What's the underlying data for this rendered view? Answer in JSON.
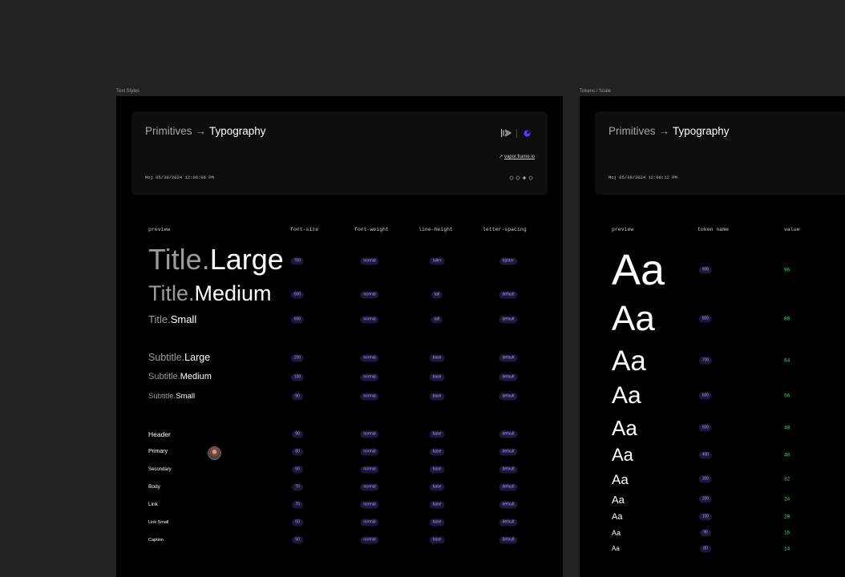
{
  "frames": {
    "text_styles": {
      "label": "Text Styles",
      "header": {
        "crumb_parent": "Primitives",
        "crumb_arrow": "→",
        "crumb_current": "Typography",
        "timestamp": "Moj 05/30/2024 12:06:06 PM",
        "link_arrow": "↗",
        "link_text": "vapor.frame.io"
      },
      "columns": [
        "preview",
        "font-size",
        "font-weight",
        "line-height",
        "letter-spacing"
      ],
      "rows": [
        {
          "prefix": "Title.",
          "name": "Large",
          "size": "700",
          "weight": "normal",
          "lh": "taller",
          "ls": "tighter"
        },
        {
          "prefix": "Title.",
          "name": "Medium",
          "size": "600",
          "weight": "normal",
          "lh": "tall",
          "ls": "default"
        },
        {
          "prefix": "Title.",
          "name": "Small",
          "size": "600",
          "weight": "normal",
          "lh": "tall",
          "ls": "default"
        },
        {
          "prefix": "Subtitle.",
          "name": "Large",
          "size": "200",
          "weight": "normal",
          "lh": "base",
          "ls": "default"
        },
        {
          "prefix": "Subtitle.",
          "name": "Medium",
          "size": "100",
          "weight": "normal",
          "lh": "base",
          "ls": "default"
        },
        {
          "prefix": "Subtitle.",
          "name": "Small",
          "size": "90",
          "weight": "normal",
          "lh": "base",
          "ls": "default"
        },
        {
          "prefix": "",
          "name": "Header",
          "size": "90",
          "weight": "normal",
          "lh": "base",
          "ls": "default"
        },
        {
          "prefix": "",
          "name": "Primary",
          "size": "80",
          "weight": "normal",
          "lh": "base",
          "ls": "default"
        },
        {
          "prefix": "",
          "name": "Secondary",
          "size": "60",
          "weight": "normal",
          "lh": "base",
          "ls": "default"
        },
        {
          "prefix": "",
          "name": "Body",
          "size": "70",
          "weight": "normal",
          "lh": "base",
          "ls": "default"
        },
        {
          "prefix": "",
          "name": "Link",
          "size": "70",
          "weight": "normal",
          "lh": "base",
          "ls": "default"
        },
        {
          "prefix": "",
          "name": "Link Small",
          "size": "60",
          "weight": "normal",
          "lh": "base",
          "ls": "default"
        },
        {
          "prefix": "",
          "name": "Caption",
          "size": "50",
          "weight": "normal",
          "lh": "base",
          "ls": "default"
        }
      ]
    },
    "tokens_scale": {
      "label": "Tokens / Scale",
      "header": {
        "crumb_parent": "Primitives",
        "crumb_arrow": "→",
        "crumb_current": "Typography",
        "timestamp": "Moj 05/30/2024 12:06:12 PM"
      },
      "columns": [
        "preview",
        "token name",
        "value"
      ],
      "sample": "Aa",
      "rows": [
        {
          "token": "900",
          "value": "96"
        },
        {
          "token": "800",
          "value": "80"
        },
        {
          "token": "700",
          "value": "64"
        },
        {
          "token": "600",
          "value": "56"
        },
        {
          "token": "500",
          "value": "48"
        },
        {
          "token": "400",
          "value": "40"
        },
        {
          "token": "300",
          "value": "32"
        },
        {
          "token": "200",
          "value": "24"
        },
        {
          "token": "100",
          "value": "20"
        },
        {
          "token": "90",
          "value": "16"
        },
        {
          "token": "80",
          "value": "14"
        }
      ]
    }
  },
  "colors": {
    "canvas": "#222222",
    "frame_bg": "#000000",
    "pill_bg": "#1d1838",
    "pill_text": "#a89cff",
    "value_text": "#4de08c"
  },
  "icons": {
    "logo": "frameio-waveform-icon",
    "avatar_dot": "blue-purple-dot-icon",
    "link": "arrow-up-right-icon",
    "shapes": "shape-indicators-icon"
  }
}
